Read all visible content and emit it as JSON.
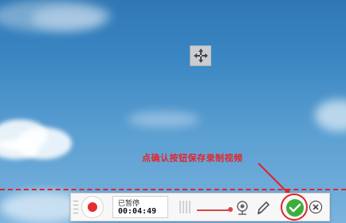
{
  "annotation": {
    "text": "点确认按钮保存录制视频"
  },
  "toolbar": {
    "status": "已暂停",
    "timer": "00:04:49",
    "volume_level": 1.0
  },
  "colors": {
    "accent_red": "#e0242a",
    "confirm_green": "#3cae3c"
  },
  "icons": {
    "move": "move-arrows-icon",
    "record": "record-dot-icon",
    "webcam": "webcam-icon",
    "pen": "pen-icon",
    "confirm": "check-circle-icon",
    "close": "close-circle-icon"
  }
}
